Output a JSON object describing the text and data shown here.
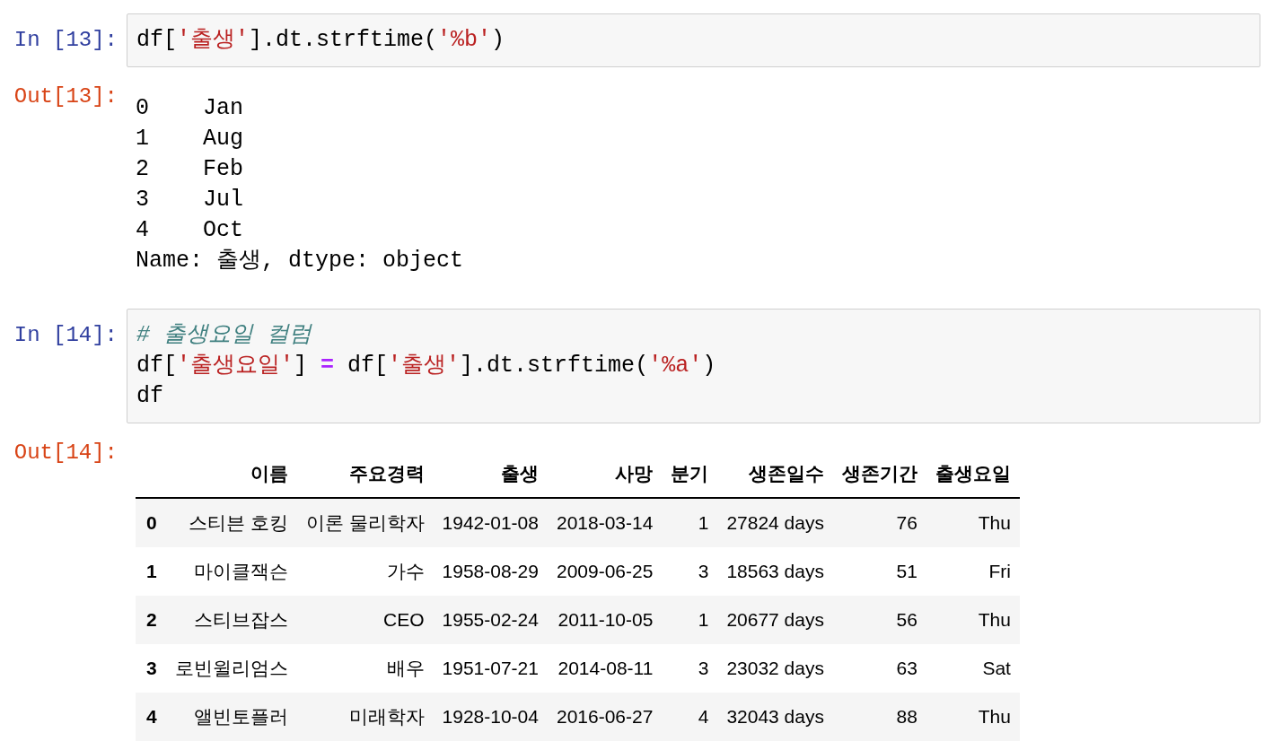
{
  "cells": [
    {
      "kind": "code",
      "prompt": "In [13]:",
      "lines": [
        [
          {
            "text": "df[",
            "kind": "plain"
          },
          {
            "text": "'출생'",
            "kind": "string"
          },
          {
            "text": "].dt.strftime(",
            "kind": "plain"
          },
          {
            "text": "'%b'",
            "kind": "string"
          },
          {
            "text": ")",
            "kind": "plain"
          }
        ]
      ]
    },
    {
      "kind": "text_output",
      "prompt": "Out[13]:",
      "lines": [
        "0    Jan",
        "1    Aug",
        "2    Feb",
        "3    Jul",
        "4    Oct",
        "Name: 출생, dtype: object"
      ]
    },
    {
      "kind": "code",
      "prompt": "In [14]:",
      "lines": [
        [
          {
            "text": "# 출생요일 컬럼",
            "kind": "comment"
          }
        ],
        [
          {
            "text": "df[",
            "kind": "plain"
          },
          {
            "text": "'출생요일'",
            "kind": "string"
          },
          {
            "text": "] ",
            "kind": "plain"
          },
          {
            "text": "=",
            "kind": "operator"
          },
          {
            "text": " df[",
            "kind": "plain"
          },
          {
            "text": "'출생'",
            "kind": "string"
          },
          {
            "text": "].dt.strftime(",
            "kind": "plain"
          },
          {
            "text": "'%a'",
            "kind": "string"
          },
          {
            "text": ")",
            "kind": "plain"
          }
        ],
        [
          {
            "text": "df",
            "kind": "plain"
          }
        ]
      ]
    },
    {
      "kind": "table_output",
      "prompt": "Out[14]:",
      "table": {
        "columns": [
          "이름",
          "주요경력",
          "출생",
          "사망",
          "분기",
          "생존일수",
          "생존기간",
          "출생요일"
        ],
        "rows": [
          {
            "index": "0",
            "cells": [
              "스티븐 호킹",
              "이론 물리학자",
              "1942-01-08",
              "2018-03-14",
              "1",
              "27824 days",
              "76",
              "Thu"
            ]
          },
          {
            "index": "1",
            "cells": [
              "마이클잭슨",
              "가수",
              "1958-08-29",
              "2009-06-25",
              "3",
              "18563 days",
              "51",
              "Fri"
            ]
          },
          {
            "index": "2",
            "cells": [
              "스티브잡스",
              "CEO",
              "1955-02-24",
              "2011-10-05",
              "1",
              "20677 days",
              "56",
              "Thu"
            ]
          },
          {
            "index": "3",
            "cells": [
              "로빈윌리엄스",
              "배우",
              "1951-07-21",
              "2014-08-11",
              "3",
              "23032 days",
              "63",
              "Sat"
            ]
          },
          {
            "index": "4",
            "cells": [
              "앨빈토플러",
              "미래학자",
              "1928-10-04",
              "2016-06-27",
              "4",
              "32043 days",
              "88",
              "Thu"
            ]
          }
        ]
      }
    }
  ]
}
